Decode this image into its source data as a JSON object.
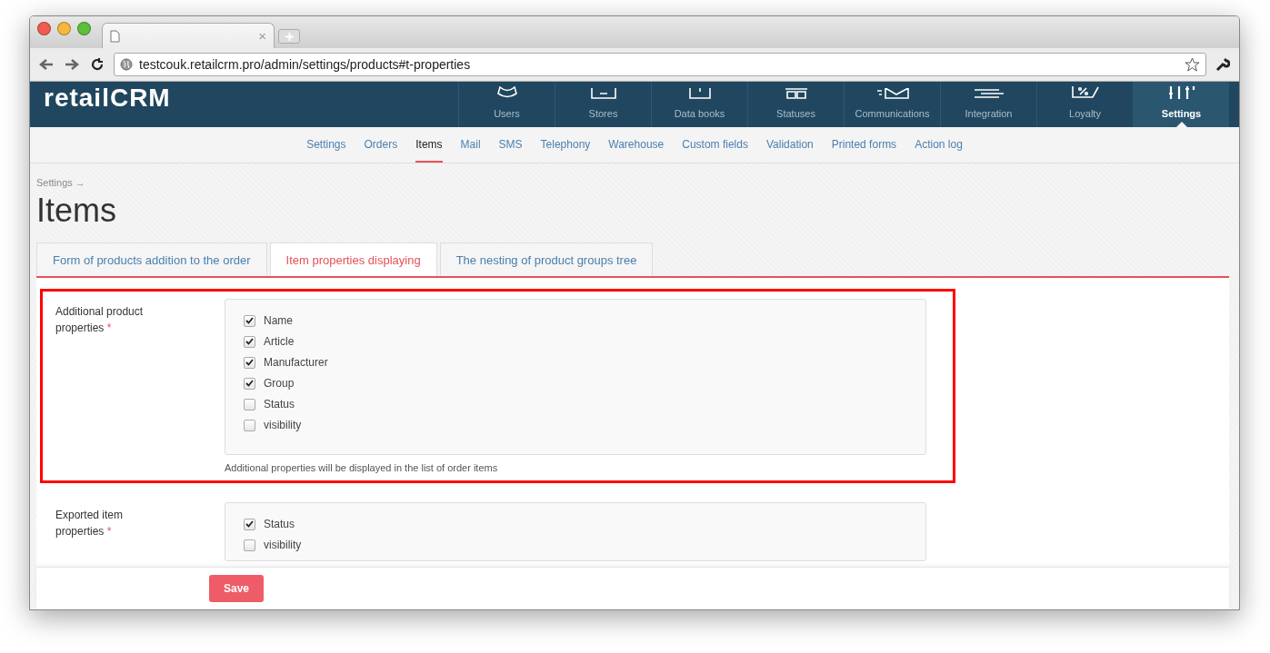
{
  "browser": {
    "tab_close": "×",
    "url": "testcouk.retailcrm.pro/admin/settings/products#t-properties"
  },
  "header": {
    "logo": "retailCRM",
    "nav": [
      {
        "label": "Users",
        "selected": false
      },
      {
        "label": "Stores",
        "selected": false
      },
      {
        "label": "Data books",
        "selected": false
      },
      {
        "label": "Statuses",
        "selected": false
      },
      {
        "label": "Communications",
        "selected": false
      },
      {
        "label": "Integration",
        "selected": false
      },
      {
        "label": "Loyalty",
        "selected": false
      },
      {
        "label": "Settings",
        "selected": true
      }
    ]
  },
  "subnav": [
    {
      "label": "Settings",
      "selected": false
    },
    {
      "label": "Orders",
      "selected": false
    },
    {
      "label": "Items",
      "selected": true
    },
    {
      "label": "Mail",
      "selected": false
    },
    {
      "label": "SMS",
      "selected": false
    },
    {
      "label": "Telephony",
      "selected": false
    },
    {
      "label": "Warehouse",
      "selected": false
    },
    {
      "label": "Custom fields",
      "selected": false
    },
    {
      "label": "Validation",
      "selected": false
    },
    {
      "label": "Printed forms",
      "selected": false
    },
    {
      "label": "Action log",
      "selected": false
    }
  ],
  "breadcrumb": "Settings →",
  "title": "Items",
  "tabs": [
    {
      "label": "Form of products addition to the order",
      "selected": false
    },
    {
      "label": "Item properties displaying",
      "selected": true
    },
    {
      "label": "The nesting of product groups tree",
      "selected": false
    }
  ],
  "fields": [
    {
      "label": "Additional product properties",
      "required_mark": "*",
      "highlighted": true,
      "options": [
        {
          "label": "Name",
          "checked": true
        },
        {
          "label": "Article",
          "checked": true
        },
        {
          "label": "Manufacturer",
          "checked": true
        },
        {
          "label": "Group",
          "checked": true
        },
        {
          "label": "Status",
          "checked": false
        },
        {
          "label": "visibility",
          "checked": false
        }
      ],
      "help": "Additional properties will be displayed in the list of order items"
    },
    {
      "label": "Exported item properties",
      "required_mark": "*",
      "highlighted": false,
      "options": [
        {
          "label": "Status",
          "checked": true
        },
        {
          "label": "visibility",
          "checked": false
        }
      ]
    }
  ],
  "save_button": "Save"
}
